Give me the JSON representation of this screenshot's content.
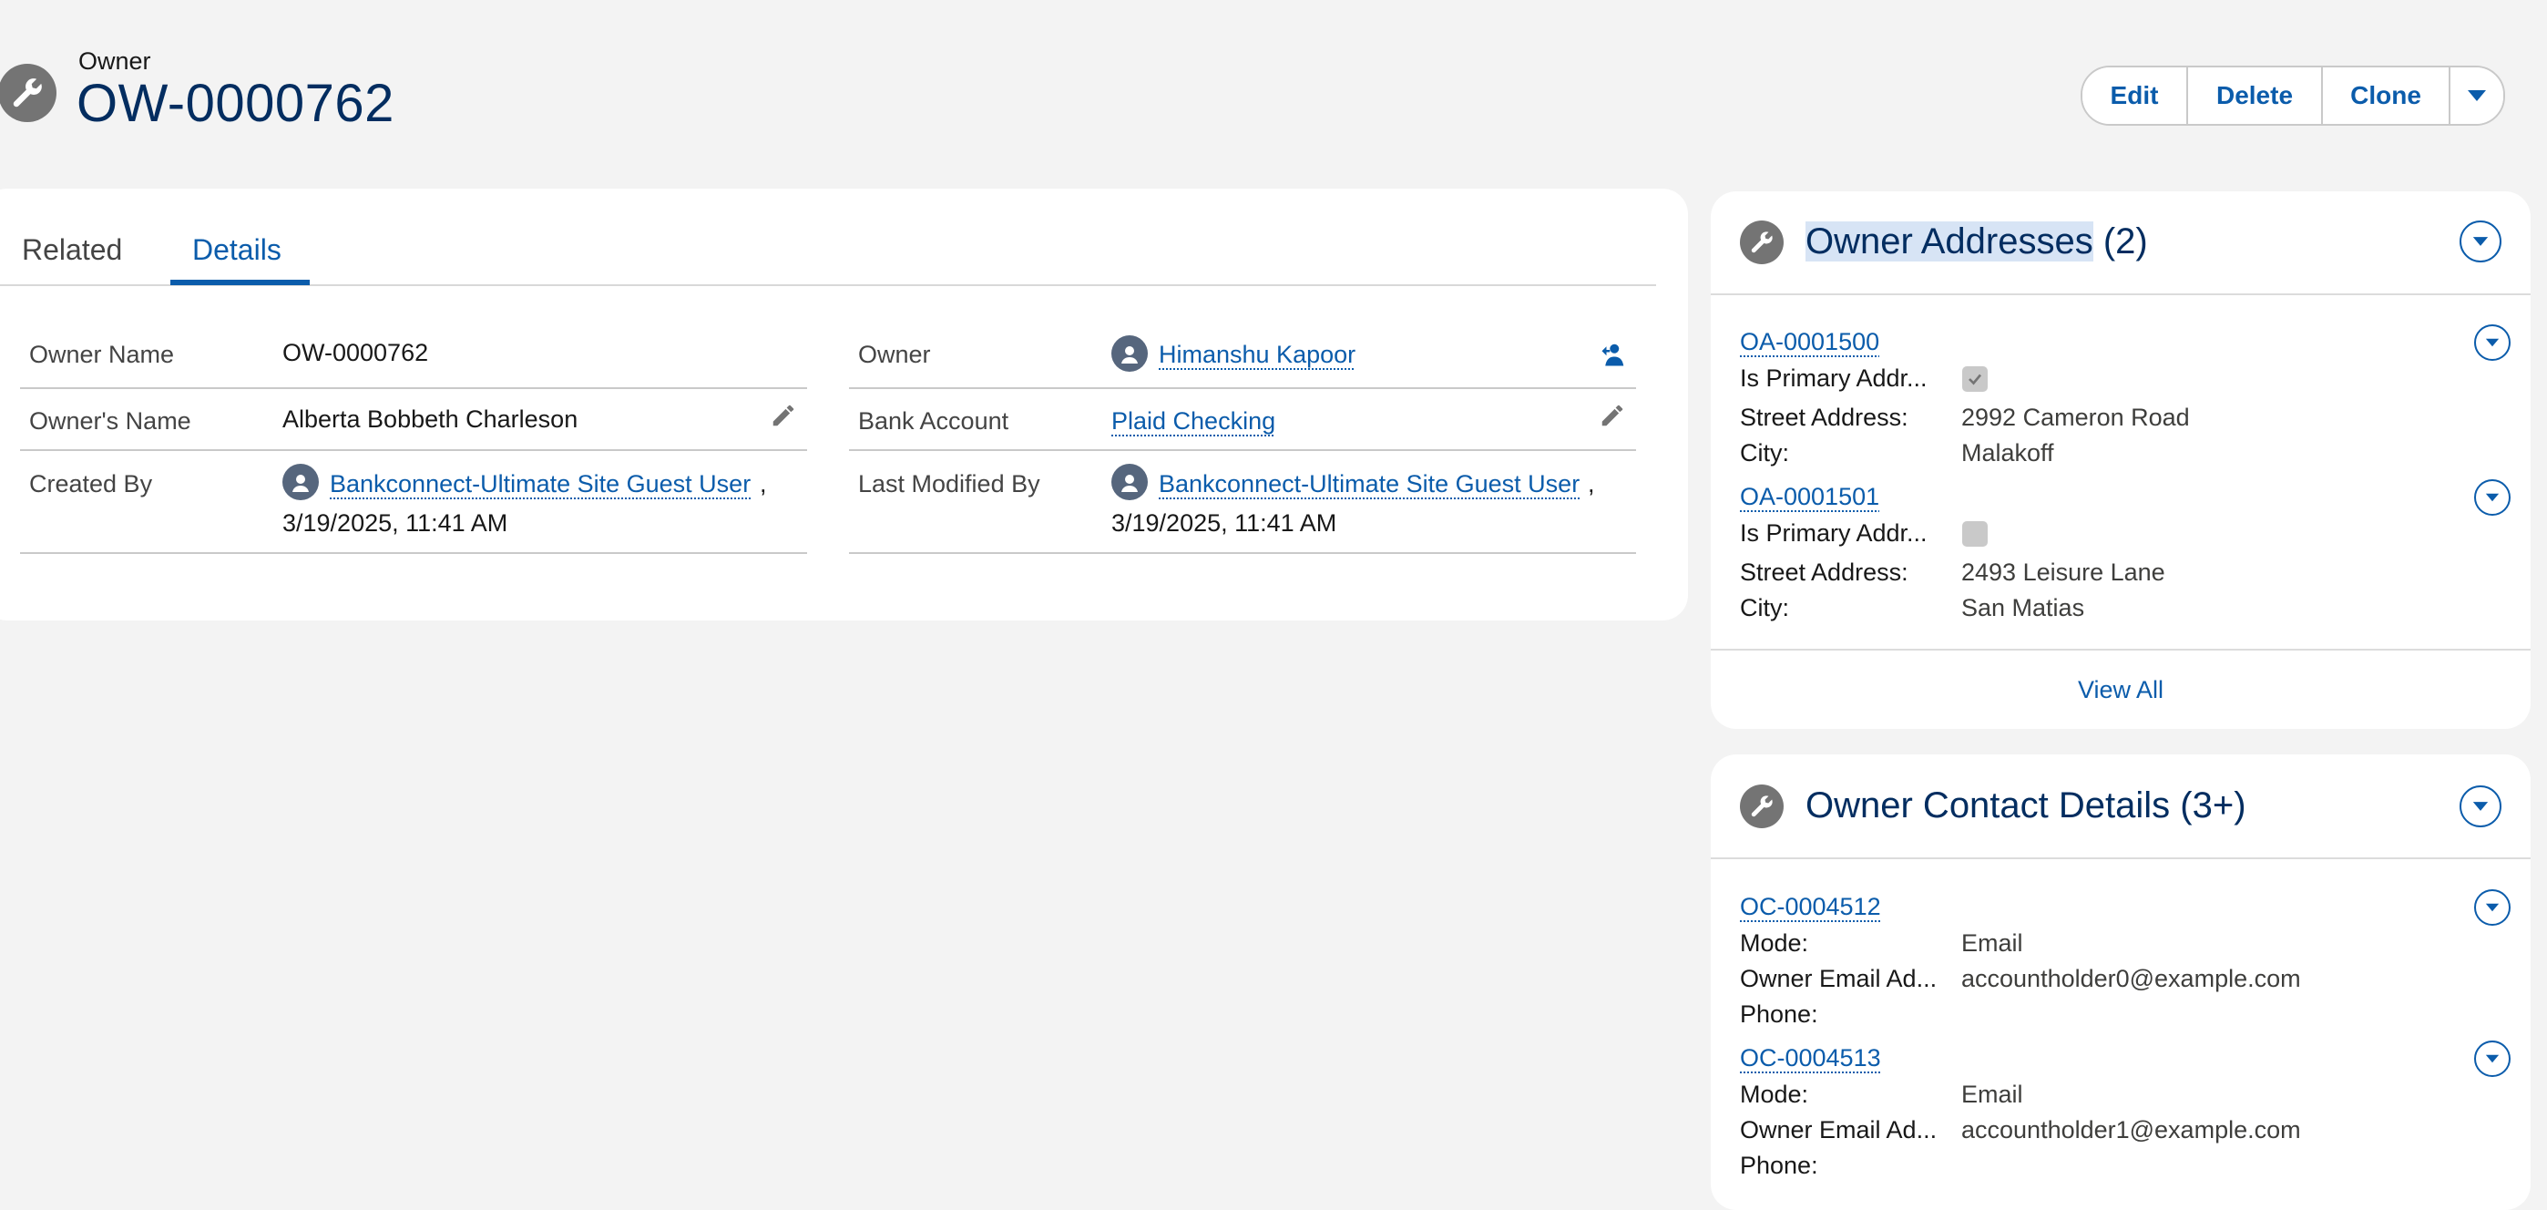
{
  "header": {
    "object_label": "Owner",
    "record_title": "OW-0000762",
    "buttons": {
      "edit": "Edit",
      "delete": "Delete",
      "clone": "Clone"
    }
  },
  "tabs": {
    "related": "Related",
    "details": "Details",
    "active": "Details"
  },
  "details": {
    "owner_name_label": "Owner Name",
    "owner_name_value": "OW-0000762",
    "owners_name_label": "Owner's Name",
    "owners_name_value": "Alberta Bobbeth Charleson",
    "created_by_label": "Created By",
    "created_by_user": "Bankconnect-Ultimate Site Guest User",
    "created_by_date": "3/19/2025, 11:41 AM",
    "owner_label": "Owner",
    "owner_value": "Himanshu Kapoor",
    "bank_account_label": "Bank Account",
    "bank_account_value": "Plaid Checking",
    "last_modified_label": "Last Modified By",
    "last_modified_user": "Bankconnect-Ultimate Site Guest User",
    "last_modified_date": "3/19/2025, 11:41 AM",
    "comma": ","
  },
  "owner_addresses": {
    "title": "Owner Addresses",
    "count": "(2)",
    "items": [
      {
        "id": "OA-0001500",
        "primary_label": "Is Primary Addr...",
        "primary_checked": true,
        "street_label": "Street Address:",
        "street": "2992 Cameron Road",
        "city_label": "City:",
        "city": "Malakoff"
      },
      {
        "id": "OA-0001501",
        "primary_label": "Is Primary Addr...",
        "primary_checked": false,
        "street_label": "Street Address:",
        "street": "2493 Leisure Lane",
        "city_label": "City:",
        "city": "San Matias"
      }
    ],
    "view_all": "View All"
  },
  "owner_contacts": {
    "title": "Owner Contact Details",
    "count": "(3+)",
    "items": [
      {
        "id": "OC-0004512",
        "mode_label": "Mode:",
        "mode": "Email",
        "email_label": "Owner Email Ad...",
        "email": "accountholder0@example.com",
        "phone_label": "Phone:",
        "phone": ""
      },
      {
        "id": "OC-0004513",
        "mode_label": "Mode:",
        "mode": "Email",
        "email_label": "Owner Email Ad...",
        "email": "accountholder1@example.com",
        "phone_label": "Phone:",
        "phone": ""
      }
    ]
  },
  "colors": {
    "brand": "#0b5cab",
    "title": "#032d60",
    "icon_bg": "#747474"
  }
}
